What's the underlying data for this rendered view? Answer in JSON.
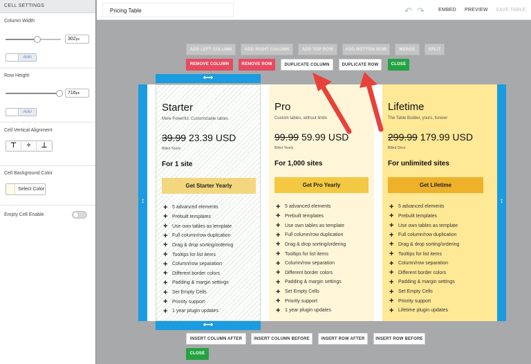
{
  "sidebar": {
    "header": "CELL SETTINGS",
    "column_width": {
      "label": "Column Width",
      "value": "302",
      "unit": "px",
      "auto_label": "Auto"
    },
    "row_height": {
      "label": "Row Height",
      "value": "716",
      "unit": "px",
      "auto_label": "Auto"
    },
    "vertical_alignment": {
      "label": "Cell Vertical Alignment",
      "top_icon": "align-top-icon",
      "middle_icon": "align-middle-icon",
      "bottom_icon": "align-bottom-icon"
    },
    "background_color": {
      "label": "Cell Background Color",
      "button": "Select Color",
      "swatch": "#fffbe6"
    },
    "empty_cell": {
      "label": "Empty Cell Enable"
    }
  },
  "topbar": {
    "title_value": "Pricing Table",
    "undo_icon": "undo-icon",
    "redo_icon": "redo-icon",
    "embed": "EMBED",
    "preview": "PREVIEW",
    "save": "SAVE TABLE"
  },
  "toolbar_top": {
    "add_left": "ADD LEFT COLUMN",
    "add_right": "ADD RIGHT COLUMN",
    "add_top": "ADD TOP ROW",
    "add_bottom": "ADD BOTTOM ROW",
    "merge": "MERGE",
    "split": "SPLIT",
    "remove_column": "REMOVE COLUMN",
    "remove_row": "REMOVE ROW",
    "duplicate_column": "DUPLICATE COLUMN",
    "duplicate_row": "DUPLICATE ROW",
    "close": "CLOSE"
  },
  "toolbar_bottom": {
    "insert_col_after": "INSERT COLUMN AFTER",
    "insert_col_before": "INSERT COLUMN BEFORE",
    "insert_row_after": "INSERT ROW AFTER",
    "insert_row_before": "INSERT ROW BEFORE",
    "close": "CLOSE"
  },
  "handles": {
    "horizontal": "⟷",
    "vertical": "↕"
  },
  "colors": {
    "accent_blue": "#1b9be0",
    "red": "#e84a5f",
    "green": "#24a243",
    "arrow": "#e8413c"
  },
  "plans": [
    {
      "name": "Starter",
      "subtitle": "More Powerful, Customizable tables",
      "old_price": "39.99",
      "new_price": "23.39 USD",
      "billing": "Billed Yearly",
      "sites": "For 1 site",
      "cta": "Get Starter Yearly"
    },
    {
      "name": "Pro",
      "subtitle": "Custom tables, without limits",
      "old_price": "99.99",
      "new_price": "59.99 USD",
      "billing": "Billed Yearly",
      "sites": "For 1,000 sites",
      "cta": "Get Pro Yearly"
    },
    {
      "name": "Lifetime",
      "subtitle": "The Table Builder, yours, forever",
      "old_price": "299.99",
      "new_price": "179.99 USD",
      "billing": "Billed Once",
      "sites": "For unlimited sites",
      "cta": "Get Lifetime"
    }
  ],
  "features": [
    "5 advanced elements",
    "Prebuilt templates",
    "Use own tables as template",
    "Full column/row duplication",
    "Drag & drop sorting/ordering",
    "Tooltips for list items",
    "Column/row separation",
    "Different border colors",
    "Padding & margin settings",
    "Set Empty Cells",
    "Priority support"
  ],
  "last_features": [
    "1 year plugin updates",
    "1 year plugin updates",
    "Lifetime plugin updates"
  ],
  "cta_colors": [
    "#f3d77e",
    "#f3c842",
    "#edb12a"
  ]
}
